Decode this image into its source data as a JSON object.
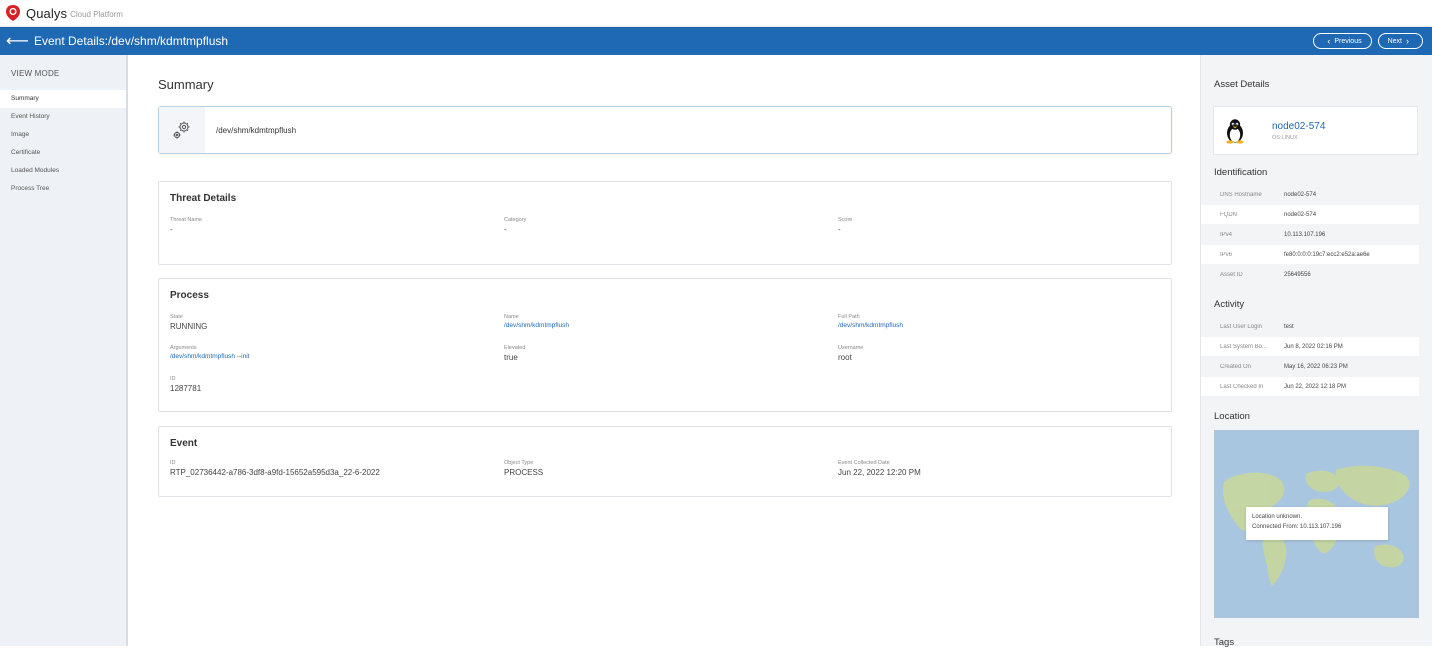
{
  "brand": {
    "name": "Qualys",
    "subtitle": "Cloud Platform",
    "color": "#d81f26"
  },
  "titlebar": {
    "title": "Event Details:/dev/shm/kdmtmpflush",
    "previous_label": "Previous",
    "next_label": "Next",
    "color": "#1f68b3"
  },
  "sidebar": {
    "heading": "VIEW MODE",
    "items": [
      {
        "label": "Summary"
      },
      {
        "label": "Event History"
      },
      {
        "label": "Image"
      },
      {
        "label": "Certificate"
      },
      {
        "label": "Loaded Modules"
      },
      {
        "label": "Process Tree"
      }
    ]
  },
  "summary": {
    "title": "Summary",
    "file_path": "/dev/shm/kdmtmpflush",
    "file_icon": "gears-icon"
  },
  "threat": {
    "title": "Threat Details",
    "fields": [
      {
        "label": "Threat Name",
        "value": "-"
      },
      {
        "label": "Category",
        "value": "-"
      },
      {
        "label": "Score",
        "value": "-"
      }
    ]
  },
  "process": {
    "title": "Process",
    "fields": [
      {
        "label": "State",
        "value": "RUNNING"
      },
      {
        "label": "Name",
        "value": "/dev/shm/kdmtmpflush"
      },
      {
        "label": "Full Path",
        "value": "/dev/shm/kdmtmpflush"
      },
      {
        "label": "Arguments",
        "value": "/dev/shm/kdmtmpflush --init"
      },
      {
        "label": "Elevated",
        "value": "true"
      },
      {
        "label": "Username",
        "value": "root"
      },
      {
        "label": "ID",
        "value": "1287781"
      }
    ]
  },
  "event": {
    "title": "Event",
    "fields": [
      {
        "label": "ID",
        "value": "RTP_02736442-a786-3df8-a9fd-15652a595d3a_22-6-2022"
      },
      {
        "label": "Object Type",
        "value": "PROCESS"
      },
      {
        "label": "Event Collected Date",
        "value": "Jun 22, 2022 12:20 PM"
      }
    ]
  },
  "asset": {
    "heading": "Asset Details",
    "name": "node02-574",
    "os": "OS:LINUX",
    "icon": "linux-tux-icon"
  },
  "identification": {
    "heading": "Identification",
    "rows": [
      {
        "k": "DNS Hostname",
        "v": "node02-574"
      },
      {
        "k": "FQDN",
        "v": "node02-574"
      },
      {
        "k": "IPv4",
        "v": "10.113.107.196"
      },
      {
        "k": "IPv6",
        "v": "fe80:0:0:0:19c7:ecc2:e52a:ae6e"
      },
      {
        "k": "Asset ID",
        "v": "25649556"
      }
    ]
  },
  "activity": {
    "heading": "Activity",
    "rows": [
      {
        "k": "Last User Login",
        "v": "test"
      },
      {
        "k": "Last System Bo...",
        "v": "Jun 8, 2022 02:16 PM"
      },
      {
        "k": "Created On",
        "v": "May 16, 2022 06:23 PM"
      },
      {
        "k": "Last Checked In",
        "v": "Jun 22, 2022 12:18 PM"
      }
    ]
  },
  "location": {
    "heading": "Location",
    "line1": "Location unknown.",
    "line2": "Connected From: 10.113.107.196"
  },
  "tags": {
    "heading": "Tags"
  }
}
